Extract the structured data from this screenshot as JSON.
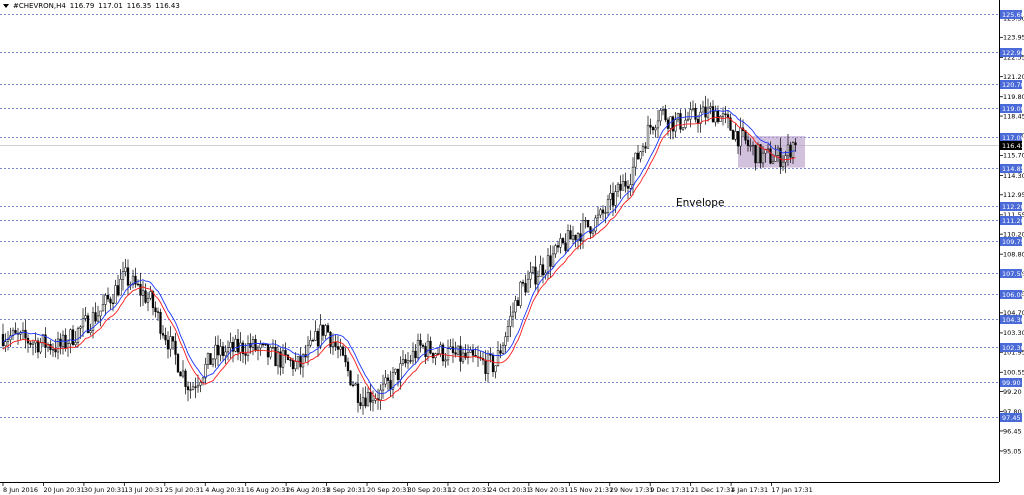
{
  "header": {
    "symbol": "#CHEVRON,H4",
    "ohlc": [
      "116.79",
      "117.01",
      "116.35",
      "116.43"
    ]
  },
  "chart_data": {
    "type": "candlestick",
    "current_price": "116.43",
    "y_tick_labels": [
      "125.30",
      "123.95",
      "122.55",
      "121.20",
      "119.80",
      "118.45",
      "117.10",
      "115.70",
      "114.30",
      "112.95",
      "111.55",
      "110.20",
      "108.80",
      "107.45",
      "106.05",
      "104.70",
      "103.30",
      "101.95",
      "100.55",
      "99.20",
      "97.80",
      "96.45",
      "95.05"
    ],
    "ylim": [
      95.05,
      126.6
    ],
    "horizontal_levels": [
      "125.60",
      "122.90",
      "120.70",
      "119.00",
      "117.00",
      "114.85",
      "112.20",
      "111.20",
      "109.75",
      "107.50",
      "106.00",
      "104.30",
      "102.30",
      "99.90",
      "97.45"
    ],
    "x_tick_labels": [
      "8 Jun 2016",
      "20 Jun 20:31",
      "30 Jun 20:31",
      "13 Jul 20:31",
      "25 Jul 20:31",
      "4 Aug 20:31",
      "16 Aug 20:31",
      "26 Aug 20:31",
      "8 Sep 20:31",
      "20 Sep 20:31",
      "30 Sep 20:31",
      "12 Oct 20:31",
      "24 Oct 20:31",
      "3 Nov 20:31",
      "15 Nov 21:31",
      "29 Nov 17:31",
      "9 Dec 17:31",
      "21 Dec 17:31",
      "4 Jan 17:31",
      "17 Jan 17:31"
    ],
    "annotation": "Envelope",
    "highlight_box": {
      "y_top": 117.05,
      "y_bottom": 114.85
    },
    "colors": {
      "upper_band": "#1a35ff",
      "lower_band": "#ff1a1a",
      "levels": "#4a5fd0",
      "highlight": "#b497c6",
      "tag": "#4a6ad8"
    }
  }
}
